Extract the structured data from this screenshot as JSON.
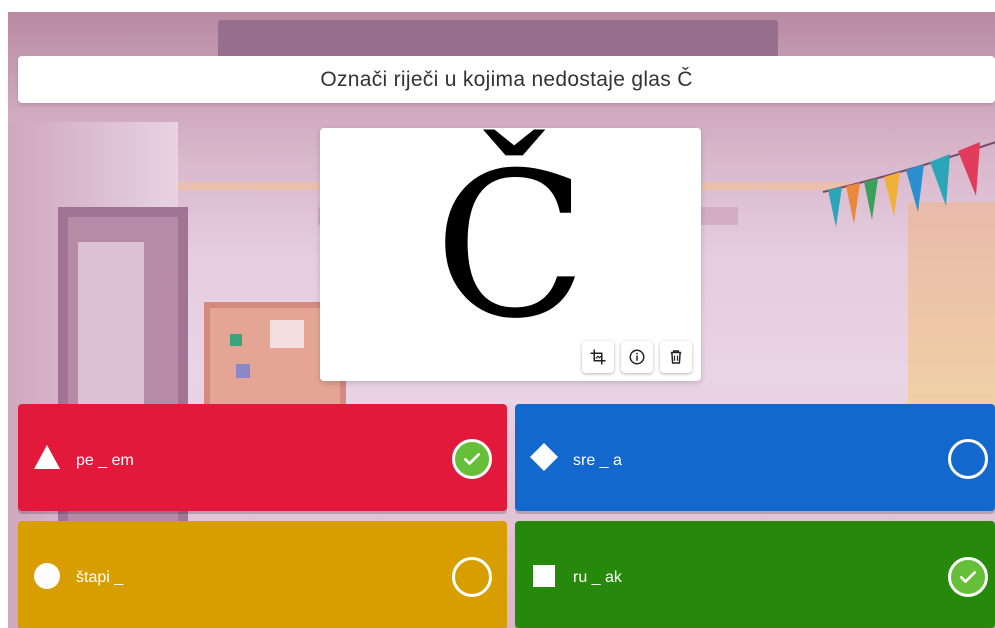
{
  "question": {
    "text": "Označi riječi u kojima nedostaje glas Č"
  },
  "media": {
    "letter": "Č",
    "actions": [
      {
        "icon": "crop-icon"
      },
      {
        "icon": "info-icon"
      },
      {
        "icon": "trash-icon"
      }
    ]
  },
  "answers": [
    {
      "label": "pe _ em",
      "shape": "triangle",
      "color": "#e2193b",
      "correct": true
    },
    {
      "label": "sre _ a",
      "shape": "diamond",
      "color": "#1368ce",
      "correct": false
    },
    {
      "label": "štapi _",
      "shape": "circle",
      "color": "#d89e00",
      "correct": false
    },
    {
      "label": "ru _ ak",
      "shape": "square",
      "color": "#26890c",
      "correct": true
    }
  ],
  "colors": {
    "correct_fill": "#66bf39",
    "red": "#e2193b",
    "blue": "#1368ce",
    "yellow": "#d89e00",
    "green": "#26890c"
  }
}
